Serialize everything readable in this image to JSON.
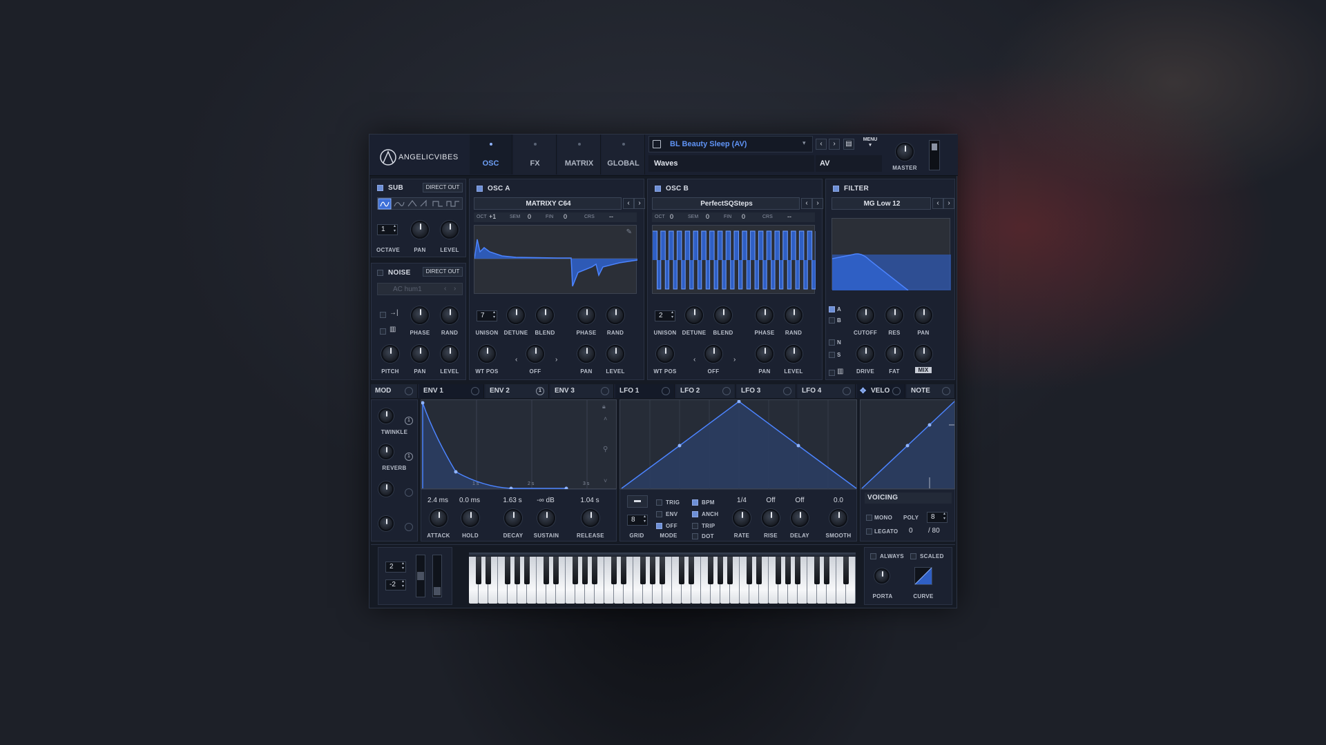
{
  "header": {
    "logo_text": "ANGELICVIBES",
    "tabs": [
      {
        "label": "OSC",
        "active": true
      },
      {
        "label": "FX",
        "active": false
      },
      {
        "label": "MATRIX",
        "active": false
      },
      {
        "label": "GLOBAL",
        "active": false
      }
    ],
    "preset_name": "BL Beauty Sleep (AV)",
    "preset_category": "Waves",
    "preset_author": "AV",
    "menu_label": "MENU",
    "master_label": "MASTER"
  },
  "sub": {
    "title": "SUB",
    "direct_out": "DIRECT OUT",
    "octave_value": "1",
    "labels": {
      "octave": "OCTAVE",
      "pan": "PAN",
      "level": "LEVEL"
    }
  },
  "noise": {
    "title": "NOISE",
    "direct_out": "DIRECT OUT",
    "sample": "AC hum1",
    "labels": {
      "phase": "PHASE",
      "rand": "RAND",
      "pitch": "PITCH",
      "pan": "PAN",
      "level": "LEVEL"
    }
  },
  "osc_a": {
    "title": "OSC A",
    "wavetable": "MATRIXY C64",
    "oct_label": "OCT",
    "oct": "+1",
    "sem_label": "SEM",
    "sem": "0",
    "fin_label": "FIN",
    "fin": "0",
    "crs_label": "CRS",
    "crs": "--",
    "unison": "7",
    "labels": {
      "unison": "UNISON",
      "detune": "DETUNE",
      "blend": "BLEND",
      "phase": "PHASE",
      "rand": "RAND",
      "wtpos": "WT POS",
      "off": "OFF",
      "pan": "PAN",
      "level": "LEVEL"
    }
  },
  "osc_b": {
    "title": "OSC B",
    "wavetable": "PerfectSQSteps",
    "oct_label": "OCT",
    "oct": "0",
    "sem_label": "SEM",
    "sem": "0",
    "fin_label": "FIN",
    "fin": "0",
    "crs_label": "CRS",
    "crs": "--",
    "unison": "2",
    "labels": {
      "unison": "UNISON",
      "detune": "DETUNE",
      "blend": "BLEND",
      "phase": "PHASE",
      "rand": "RAND",
      "wtpos": "WT POS",
      "off": "OFF",
      "pan": "PAN",
      "level": "LEVEL"
    }
  },
  "filter": {
    "title": "FILTER",
    "type": "MG Low 12",
    "routes": [
      "A",
      "B",
      "N",
      "S"
    ],
    "labels": {
      "cutoff": "CUTOFF",
      "res": "RES",
      "pan": "PAN",
      "drive": "DRIVE",
      "fat": "FAT",
      "mix": "MIX"
    }
  },
  "mod": {
    "tabs": [
      "MOD",
      "ENV 1",
      "ENV 2",
      "ENV 3",
      "LFO 1",
      "LFO 2",
      "LFO 3",
      "LFO 4",
      "VELO",
      "NOTE"
    ],
    "env2_badge": "1",
    "macros": [
      {
        "label": "TWINKLE",
        "badge": "1"
      },
      {
        "label": "REVERB",
        "badge": "1"
      }
    ],
    "env_time_marks": [
      "1 s",
      "2 s",
      "3 s"
    ],
    "env_values": {
      "attack": "2.4 ms",
      "hold": "0.0 ms",
      "decay": "1.63 s",
      "sustain": "-∞ dB",
      "release": "1.04 s"
    },
    "env_labels": {
      "attack": "ATTACK",
      "hold": "HOLD",
      "decay": "DECAY",
      "sustain": "SUSTAIN",
      "release": "RELEASE"
    },
    "lfo": {
      "grid": "8",
      "grid_label": "GRID",
      "mode_opts": [
        "TRIG",
        "ENV",
        "OFF"
      ],
      "mode_label": "MODE",
      "dot_opts": [
        "BPM",
        "ANCH",
        "TRIP",
        "DOT"
      ],
      "rate": "1/4",
      "rise": "Off",
      "delay": "Off",
      "smooth": "0.0",
      "labels": {
        "rate": "RATE",
        "rise": "RISE",
        "delay": "DELAY",
        "smooth": "SMOOTH"
      }
    }
  },
  "voicing": {
    "title": "VOICING",
    "mono": "MONO",
    "poly": "POLY",
    "poly_value": "8",
    "legato": "LEGATO",
    "voices": "0",
    "voices_max": "/ 80",
    "always": "ALWAYS",
    "scaled": "SCALED",
    "porta": "PORTA",
    "curve": "CURVE"
  },
  "keyboard": {
    "octave_up": "2",
    "octave_down": "-2"
  },
  "colors": {
    "accent": "#6d9ff5",
    "wave_fill": "#2f5fc4",
    "wave_line": "#4c84ff"
  }
}
